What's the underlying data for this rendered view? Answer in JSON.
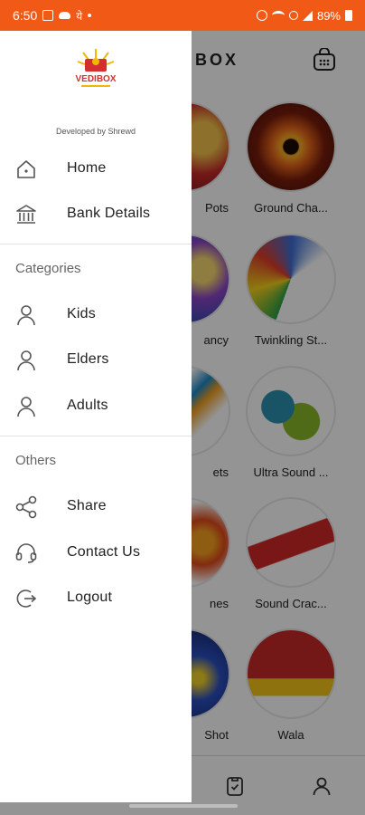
{
  "status_bar": {
    "time": "6:50",
    "network_glyph": "ये",
    "battery": "89%"
  },
  "app": {
    "title": "BOX",
    "tiles": [
      {
        "label": "Pots",
        "color": "#c52a2a"
      },
      {
        "label": "Ground Cha...",
        "color": "#e8691a"
      },
      {
        "label": "ancy",
        "color": "#3048b0"
      },
      {
        "label": "Twinkling St...",
        "color": "#2aa146"
      },
      {
        "label": "ets",
        "color": "#1e88c5"
      },
      {
        "label": "Ultra Sound ...",
        "color": "#8ab82a"
      },
      {
        "label": "nes",
        "color": "#e04a1c"
      },
      {
        "label": "Sound Crac...",
        "color": "#d02626"
      },
      {
        "label": "Shot",
        "color": "#2a4fc2"
      },
      {
        "label": "Wala",
        "color": "#c62828"
      }
    ]
  },
  "drawer": {
    "logo_text": "VEDIBOX",
    "developer_credit": "Developed by Shrewd",
    "items": [
      {
        "label": "Home",
        "icon": "home-icon"
      },
      {
        "label": "Bank Details",
        "icon": "bank-icon"
      }
    ],
    "categories_title": "Categories",
    "categories": [
      {
        "label": "Kids",
        "icon": "person-icon"
      },
      {
        "label": "Elders",
        "icon": "person-icon"
      },
      {
        "label": "Adults",
        "icon": "person-icon"
      }
    ],
    "others_title": "Others",
    "others": [
      {
        "label": "Share",
        "icon": "share-icon"
      },
      {
        "label": "Contact Us",
        "icon": "headset-icon"
      },
      {
        "label": "Logout",
        "icon": "logout-icon"
      }
    ]
  },
  "colors": {
    "status_bar": "#f15a16",
    "drawer_bg": "#ffffff",
    "text": "#222222",
    "section_text": "#666666"
  }
}
